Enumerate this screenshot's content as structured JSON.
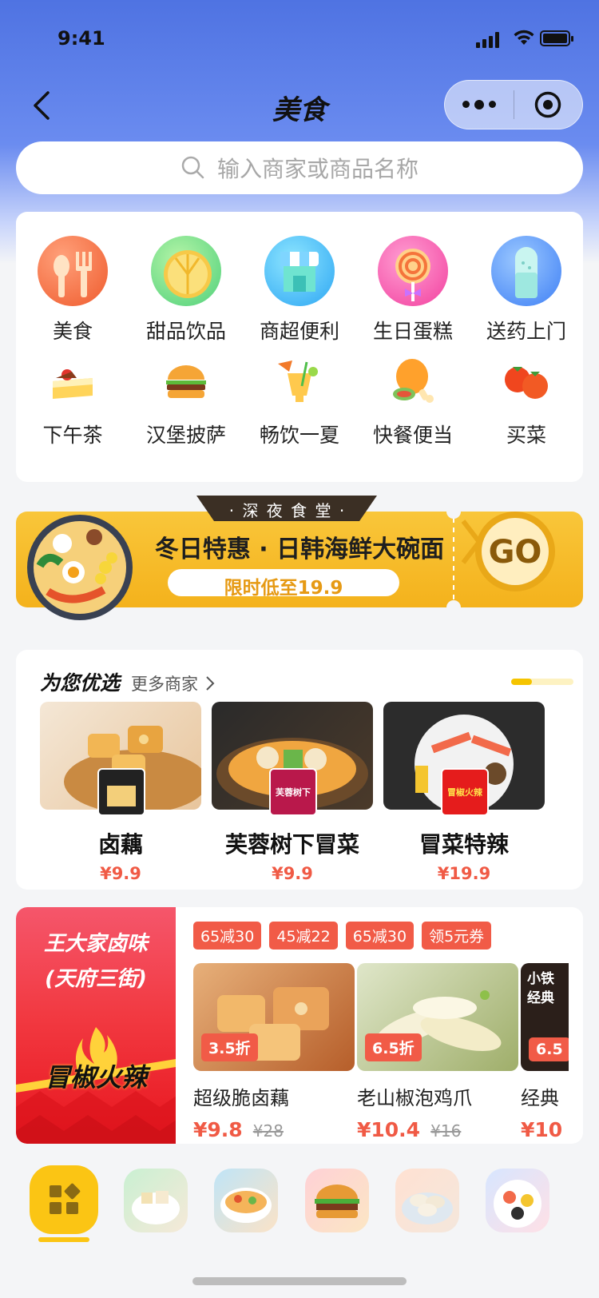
{
  "status_bar": {
    "time": "9:41"
  },
  "nav": {
    "title": "美食"
  },
  "search": {
    "placeholder": "输入商家或商品名称"
  },
  "categories": {
    "row1": [
      {
        "label": "美食",
        "icon": "fork-knife-icon"
      },
      {
        "label": "甜品饮品",
        "icon": "lemon-slice-icon"
      },
      {
        "label": "商超便利",
        "icon": "storefront-icon"
      },
      {
        "label": "生日蛋糕",
        "icon": "lollipop-icon"
      },
      {
        "label": "送药上门",
        "icon": "pill-capsule-icon"
      }
    ],
    "row2": [
      {
        "label": "下午茶",
        "icon": "cake-slice-icon"
      },
      {
        "label": "汉堡披萨",
        "icon": "burger-icon"
      },
      {
        "label": "畅饮一夏",
        "icon": "cocktail-icon"
      },
      {
        "label": "快餐便当",
        "icon": "chicken-leg-icon"
      },
      {
        "label": "买菜",
        "icon": "tomato-icon"
      }
    ]
  },
  "banner": {
    "tag": "· 深 夜 食 堂 ·",
    "headline": "冬日特惠 · 日韩海鲜大碗面",
    "sub": "限时低至19.9",
    "go": "GO"
  },
  "picks": {
    "title": "为您优选",
    "more": "更多商家",
    "items": [
      {
        "name": "卤藕",
        "price": "¥9.9"
      },
      {
        "name": "芙蓉树下冒菜",
        "price": "¥9.9",
        "badge": "芙蓉树下"
      },
      {
        "name": "冒菜特辣",
        "price": "¥19.9",
        "badge": "冒椒火辣"
      }
    ]
  },
  "shop": {
    "name_line1": "王大家卤味",
    "name_line2": "(天府三街)",
    "logo_text": "冒椒火辣",
    "coupons": [
      "65减30",
      "45减22",
      "65减30",
      "领5元券"
    ],
    "products": [
      {
        "name": "超级脆卤藕",
        "discount": "3.5折",
        "price": "¥9.8",
        "old_price": "¥28"
      },
      {
        "name": "老山椒泡鸡爪",
        "discount": "6.5折",
        "price": "¥10.4",
        "old_price": "¥16"
      },
      {
        "name": "经典",
        "discount": "6.5",
        "price": "¥10",
        "old_price": "",
        "overlay": "小铁\n经典"
      }
    ]
  },
  "colors": {
    "brand_blue": "#4f73e2",
    "accent_red": "#f05a45",
    "accent_yellow": "#fbc514"
  }
}
